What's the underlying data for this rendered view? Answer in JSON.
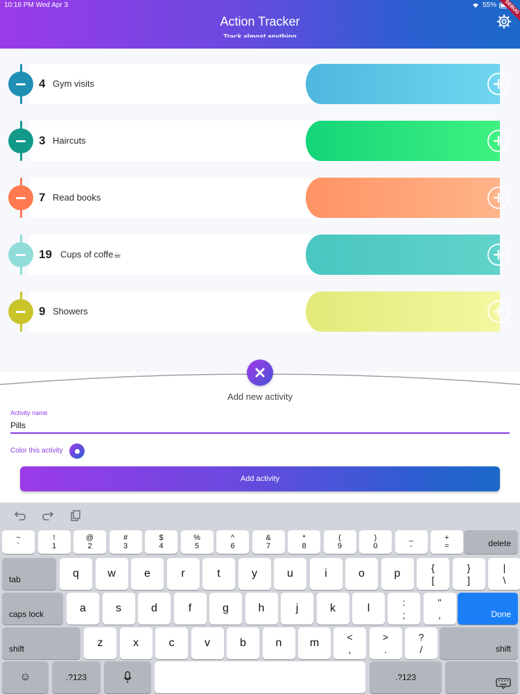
{
  "status_bar": {
    "time": "10:16 PM",
    "date": "Wed Apr 3",
    "battery": "55%",
    "debug_label": "DEBUG"
  },
  "header": {
    "title": "Action Tracker",
    "subtitle": "Track almost anything"
  },
  "activities": [
    {
      "count": "4",
      "label": "Gym visits",
      "color": "#1f8fb3",
      "bar_from": "#4fb7de",
      "bar_to": "#70d6f0"
    },
    {
      "count": "3",
      "label": "Haircuts",
      "color": "#12998a",
      "bar_from": "#14d479",
      "bar_to": "#3ef281"
    },
    {
      "count": "7",
      "label": "Read books",
      "color": "#ff7a50",
      "bar_from": "#ff9364",
      "bar_to": "#ffb48a"
    },
    {
      "count": "19",
      "label": "Cups of coffe☕",
      "color": "#8fdcd8",
      "bar_from": "#49c6c0",
      "bar_to": "#61d3ca"
    },
    {
      "count": "9",
      "label": "Showers",
      "color": "#c9c42a",
      "bar_from": "#e2ea7a",
      "bar_to": "#f3f7a0"
    }
  ],
  "add_sheet": {
    "title": "Add new activity",
    "field_label": "Activity name",
    "field_value": "Pills",
    "color_label": "Color this activity",
    "button_label": "Add activity"
  },
  "keyboard": {
    "row1": [
      {
        "top": "~",
        "bot": "`"
      },
      {
        "top": "!",
        "bot": "1"
      },
      {
        "top": "@",
        "bot": "2"
      },
      {
        "top": "#",
        "bot": "3"
      },
      {
        "top": "$",
        "bot": "4"
      },
      {
        "top": "%",
        "bot": "5"
      },
      {
        "top": "^",
        "bot": "6"
      },
      {
        "top": "&",
        "bot": "7"
      },
      {
        "top": "*",
        "bot": "8"
      },
      {
        "top": "(",
        "bot": "9"
      },
      {
        "top": ")",
        "bot": "0"
      },
      {
        "top": "_",
        "bot": "-"
      },
      {
        "top": "+",
        "bot": "="
      }
    ],
    "delete": "delete",
    "tab": "tab",
    "row2": [
      "q",
      "w",
      "e",
      "r",
      "t",
      "y",
      "u",
      "i",
      "o",
      "p"
    ],
    "row2_extra": [
      {
        "top": "{",
        "bot": "["
      },
      {
        "top": "}",
        "bot": "]"
      },
      {
        "top": "|",
        "bot": "\\"
      }
    ],
    "caps": "caps lock",
    "row3": [
      "a",
      "s",
      "d",
      "f",
      "g",
      "h",
      "j",
      "k",
      "l"
    ],
    "row3_extra": [
      {
        "top": ":",
        "bot": ";"
      },
      {
        "top": "\"",
        "bot": ","
      }
    ],
    "done": "Done",
    "shift": "shift",
    "row4": [
      "z",
      "x",
      "c",
      "v",
      "b",
      "n",
      "m"
    ],
    "row4_extra": [
      {
        "top": "<",
        "bot": ","
      },
      {
        "top": ">",
        "bot": "."
      },
      {
        "top": "?",
        "bot": "/"
      }
    ],
    "numbers": ".?123",
    "emoji": "☺"
  }
}
